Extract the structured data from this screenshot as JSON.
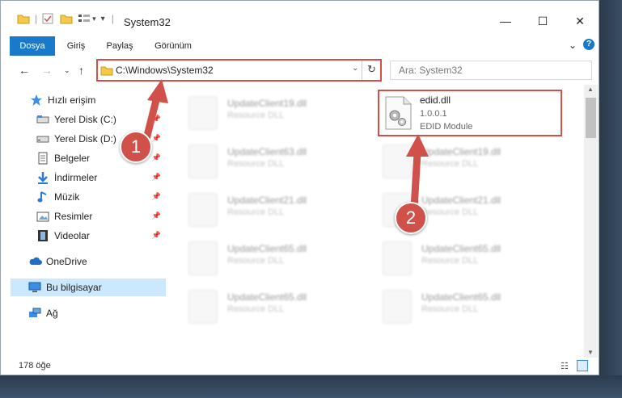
{
  "window": {
    "title": "System32"
  },
  "ribbon": {
    "tabs": [
      "Dosya",
      "Giriş",
      "Paylaş",
      "Görünüm"
    ]
  },
  "address": {
    "path": "C:\\Windows\\System32"
  },
  "search": {
    "placeholder": "Ara: System32"
  },
  "sidebar": {
    "items": [
      {
        "label": "Hızlı erişim",
        "icon": "star-icon"
      },
      {
        "label": "Yerel Disk (C:)",
        "icon": "drive-icon"
      },
      {
        "label": "Yerel Disk (D:)",
        "icon": "drive-icon"
      },
      {
        "label": "Belgeler",
        "icon": "documents-icon"
      },
      {
        "label": "İndirmeler",
        "icon": "download-icon"
      },
      {
        "label": "Müzik",
        "icon": "music-icon"
      },
      {
        "label": "Resimler",
        "icon": "pictures-icon"
      },
      {
        "label": "Videolar",
        "icon": "video-icon"
      },
      {
        "label": "OneDrive",
        "icon": "cloud-icon"
      },
      {
        "label": "Bu bilgisayar",
        "icon": "computer-icon"
      },
      {
        "label": "Ağ",
        "icon": "network-icon"
      }
    ]
  },
  "files": {
    "highlighted": {
      "name": "edid.dll",
      "version": "1.0.0.1",
      "description": "EDID Module"
    },
    "blurred": [
      {
        "name": "UpdateClient19.dll",
        "type": "Resource DLL"
      },
      {
        "name": "UpdateClient63.dll",
        "type": "Resource DLL"
      },
      {
        "name": "UpdateClient19.dll",
        "type": "Resource DLL"
      },
      {
        "name": "UpdateClient21.dll",
        "type": "Resource DLL"
      },
      {
        "name": "UpdateClient21.dll",
        "type": "Resource DLL"
      },
      {
        "name": "UpdateClient65.dll",
        "type": "Resource DLL"
      },
      {
        "name": "UpdateClient65.dll",
        "type": "Resource DLL"
      },
      {
        "name": "UpdateClient65.dll",
        "type": "Resource DLL"
      },
      {
        "name": "UpdateClient65.dll",
        "type": "Resource DLL"
      }
    ]
  },
  "status": {
    "count": "178 öğe"
  },
  "annotations": {
    "step1": "1",
    "step2": "2"
  },
  "colors": {
    "accent": "#1979ca",
    "highlight": "#d0504a",
    "selected": "#cce8ff"
  }
}
